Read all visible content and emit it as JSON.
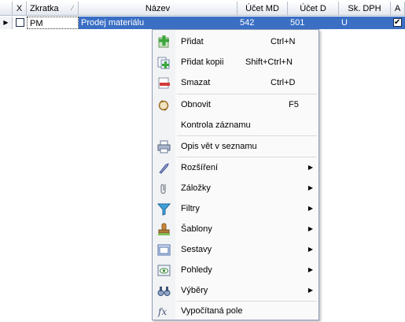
{
  "grid": {
    "columns": [
      "X",
      "Zkratka",
      "Název",
      "Účet MD",
      "Účet D",
      "Sk. DPH",
      "A"
    ],
    "row": {
      "x_checked": false,
      "zkratka": "PM",
      "nazev": "Prodej materiálu",
      "ucet_md": "542",
      "ucet_d": "501",
      "sk_dph": "U",
      "a_checked": true
    }
  },
  "menu": {
    "items": [
      {
        "label": "Přidat",
        "shortcut": "Ctrl+N",
        "icon": "add-icon",
        "submenu": false
      },
      {
        "label": "Přidat kopii",
        "shortcut": "Shift+Ctrl+N",
        "icon": "add-copy-icon",
        "submenu": false
      },
      {
        "label": "Smazat",
        "shortcut": "Ctrl+D",
        "icon": "delete-icon",
        "submenu": false
      },
      {
        "label": "Obnovit",
        "shortcut": "F5",
        "icon": "refresh-icon",
        "submenu": false
      },
      {
        "label": "Kontrola záznamu",
        "shortcut": "",
        "icon": "",
        "submenu": false
      },
      {
        "label": "Opis vět v seznamu",
        "shortcut": "",
        "icon": "printer-icon",
        "submenu": false
      },
      {
        "label": "Rozšíření",
        "shortcut": "",
        "icon": "extension-icon",
        "submenu": true
      },
      {
        "label": "Záložky",
        "shortcut": "",
        "icon": "paperclip-icon",
        "submenu": true
      },
      {
        "label": "Filtry",
        "shortcut": "",
        "icon": "filter-icon",
        "submenu": true
      },
      {
        "label": "Šablony",
        "shortcut": "",
        "icon": "stamp-icon",
        "submenu": true
      },
      {
        "label": "Sestavy",
        "shortcut": "",
        "icon": "report-icon",
        "submenu": true
      },
      {
        "label": "Pohledy",
        "shortcut": "",
        "icon": "view-icon",
        "submenu": true
      },
      {
        "label": "Výběry",
        "shortcut": "",
        "icon": "binoculars-icon",
        "submenu": true
      },
      {
        "label": "Vypočítaná pole",
        "shortcut": "",
        "icon": "formula-icon",
        "submenu": false
      }
    ]
  },
  "colors": {
    "selection": "#3a6fc4",
    "menu_border": "#8c9cb7",
    "header_border": "#b7bfcc"
  }
}
